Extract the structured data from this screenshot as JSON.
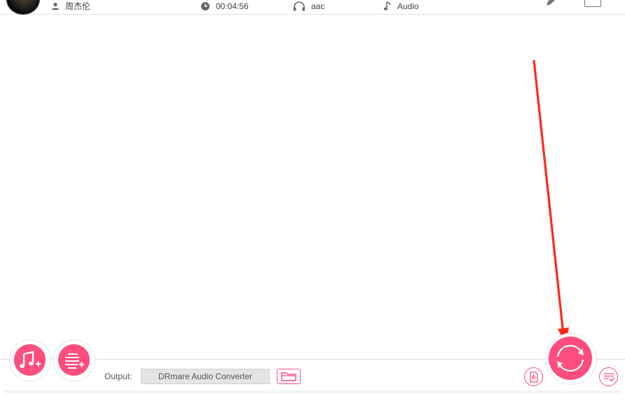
{
  "track": {
    "artist": "周杰伦",
    "duration": "00:04:56",
    "format": "aac",
    "type": "Audio"
  },
  "bottom": {
    "output_label": "Output:",
    "output_path": "DRmare Audio Converter"
  },
  "colors": {
    "accent": "#ff4d7e",
    "annotation_arrow": "#ff2a1a"
  }
}
